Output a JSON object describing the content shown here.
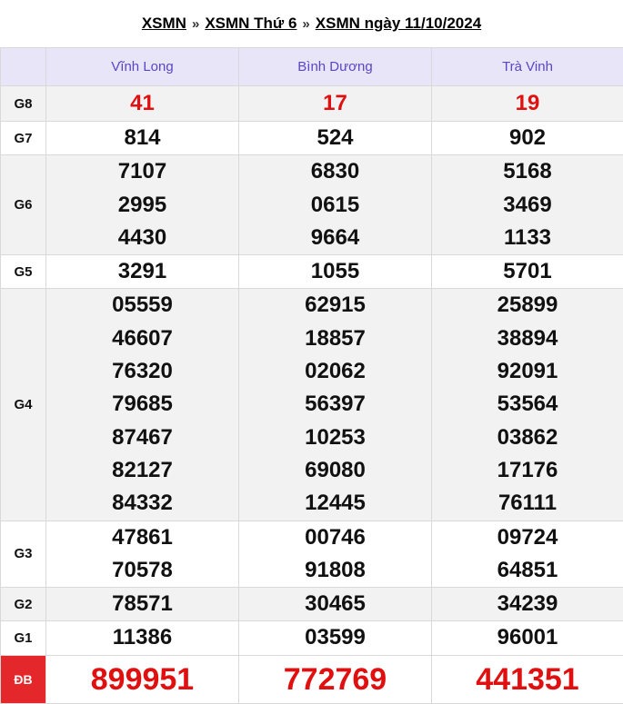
{
  "breadcrumb": {
    "link1": "XSMN",
    "sep1": "»",
    "link2": "XSMN Thứ 6",
    "sep2": "»",
    "link3": "XSMN ngày 11/10/2024"
  },
  "provinces": [
    "Vĩnh Long",
    "Bình Dương",
    "Trà Vinh"
  ],
  "prizes": [
    {
      "label": "G8",
      "values": [
        [
          "41"
        ],
        [
          "17"
        ],
        [
          "19"
        ]
      ]
    },
    {
      "label": "G7",
      "values": [
        [
          "814"
        ],
        [
          "524"
        ],
        [
          "902"
        ]
      ]
    },
    {
      "label": "G6",
      "values": [
        [
          "7107",
          "2995",
          "4430"
        ],
        [
          "6830",
          "0615",
          "9664"
        ],
        [
          "5168",
          "3469",
          "1133"
        ]
      ]
    },
    {
      "label": "G5",
      "values": [
        [
          "3291"
        ],
        [
          "1055"
        ],
        [
          "5701"
        ]
      ]
    },
    {
      "label": "G4",
      "values": [
        [
          "05559",
          "46607",
          "76320",
          "79685",
          "87467",
          "82127",
          "84332"
        ],
        [
          "62915",
          "18857",
          "02062",
          "56397",
          "10253",
          "69080",
          "12445"
        ],
        [
          "25899",
          "38894",
          "92091",
          "53564",
          "03862",
          "17176",
          "76111"
        ]
      ]
    },
    {
      "label": "G3",
      "values": [
        [
          "47861",
          "70578"
        ],
        [
          "00746",
          "91808"
        ],
        [
          "09724",
          "64851"
        ]
      ]
    },
    {
      "label": "G2",
      "values": [
        [
          "78571"
        ],
        [
          "30465"
        ],
        [
          "34239"
        ]
      ]
    },
    {
      "label": "G1",
      "values": [
        [
          "11386"
        ],
        [
          "03599"
        ],
        [
          "96001"
        ]
      ]
    },
    {
      "label": "ĐB",
      "values": [
        [
          "899951"
        ],
        [
          "772769"
        ],
        [
          "441351"
        ]
      ]
    }
  ],
  "colors": {
    "header_text": "#5a45c4",
    "header_bg": "#e9e5f8",
    "red": "#e01010",
    "db_bg": "#e3272b"
  }
}
